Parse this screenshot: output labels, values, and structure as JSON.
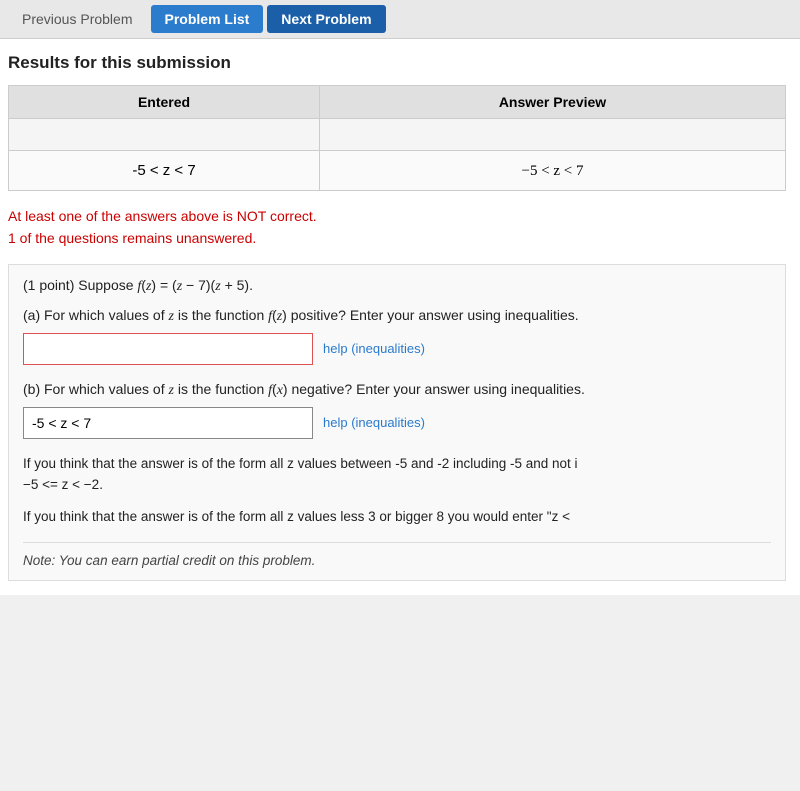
{
  "nav": {
    "previous_label": "Previous Problem",
    "list_label": "Problem List",
    "next_label": "Next Problem"
  },
  "results_section": {
    "title": "Results for this submission",
    "table": {
      "col_entered": "Entered",
      "col_preview": "Answer Preview",
      "rows": [
        {
          "entered": "",
          "preview": ""
        },
        {
          "entered": "-5 < z < 7",
          "preview": "−5 < z < 7"
        }
      ]
    },
    "status_line1": "At least one of the answers above is NOT correct.",
    "status_line2": "1 of the questions remains unanswered."
  },
  "problem": {
    "points": "(1 point) Suppose f(z) = (z − 7)(z + 5).",
    "part_a": {
      "label": "(a)",
      "question": "For which values of z is the function f(z) positive? Enter your answer using inequalities.",
      "input_value": "",
      "help_text": "help (inequalities)"
    },
    "part_b": {
      "label": "(b)",
      "question": "For which values of z is the function f(x) negative? Enter your answer using inequalities.",
      "input_value": "-5 < z < 7",
      "help_text": "help (inequalities)"
    },
    "hint1": "If you think that the answer is of the form all z values between -5 and -2 including -5 and not i",
    "hint1_formula": "−5 <= z < −2.",
    "hint2": "If you think that the answer is of the form all z values less 3 or bigger 8 you would enter \"z <",
    "note": "Note: You can earn partial credit on this problem."
  }
}
